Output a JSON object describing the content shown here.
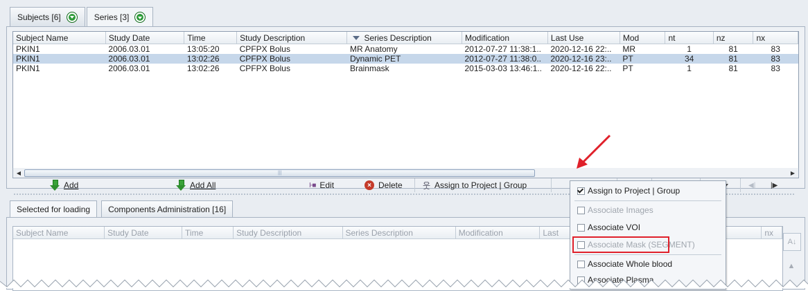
{
  "top_tabs": [
    {
      "label": "Subjects [6]"
    },
    {
      "label": "Series [3]"
    }
  ],
  "series_table": {
    "columns": [
      "Subject Name",
      "Study Date",
      "Time",
      "Study Description",
      "Series Description",
      "Modification",
      "Last Use",
      "Mod",
      "nt",
      "nz",
      "nx"
    ],
    "rows": [
      [
        "PKIN1",
        "2006.03.01",
        "13:05:20",
        "CPFPX Bolus",
        "MR Anatomy",
        "2012-07-27 11:38:1..",
        "2020-12-16 22:..",
        "MR",
        "1",
        "81",
        "83"
      ],
      [
        "PKIN1",
        "2006.03.01",
        "13:02:26",
        "CPFPX Bolus",
        "Dynamic PET",
        "2012-07-27 11:38:0..",
        "2020-12-16 23:..",
        "PT",
        "34",
        "81",
        "83"
      ],
      [
        "PKIN1",
        "2006.03.01",
        "13:02:26",
        "CPFPX Bolus",
        "Brainmask",
        "2015-03-03 13:46:1..",
        "2020-12-16 22:..",
        "PT",
        "1",
        "81",
        "83"
      ]
    ],
    "selected_row": 1
  },
  "toolbar": {
    "add": "Add",
    "add_all": "Add All",
    "edit": "Edit",
    "delete": "Delete",
    "assign": "Assign to Project | Group"
  },
  "bottom_tabs": [
    {
      "label": "Selected for loading"
    },
    {
      "label": "Components Administration [16]"
    }
  ],
  "loading_table": {
    "columns": [
      "Subject Name",
      "Study Date",
      "Time",
      "Study Description",
      "Series Description",
      "Modification",
      "Last",
      "nx"
    ]
  },
  "popup_menu": {
    "items": [
      {
        "label": "Assign to Project | Group",
        "checked": true,
        "disabled": false
      },
      {
        "label": "Associate Images",
        "checked": false,
        "disabled": true
      },
      {
        "label": "Associate VOI",
        "checked": false,
        "disabled": false,
        "highlighted": true
      },
      {
        "label": "Associate Mask (SEGMENT)",
        "checked": false,
        "disabled": true
      },
      {
        "label": "Associate Whole blood",
        "checked": false,
        "disabled": false
      },
      {
        "label": "Associate Plasma",
        "checked": false,
        "disabled": false
      }
    ]
  },
  "colors": {
    "highlight": "#e0202a",
    "selected_row": "#c6d7ea",
    "accent_green": "#2e9b3a"
  }
}
